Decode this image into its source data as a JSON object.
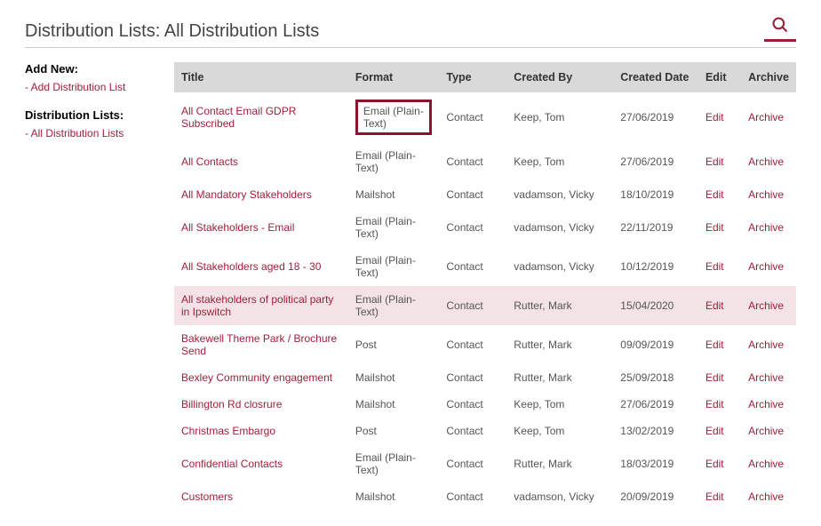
{
  "header": {
    "title": "Distribution Lists: All Distribution Lists"
  },
  "sidebar": {
    "add_new_heading": "Add New:",
    "add_link": "Add Distribution List",
    "lists_heading": "Distribution Lists:",
    "all_link": "All Distribution Lists"
  },
  "table": {
    "headers": {
      "title": "Title",
      "format": "Format",
      "type": "Type",
      "created_by": "Created By",
      "created_date": "Created Date",
      "edit": "Edit",
      "archive": "Archive"
    },
    "labels": {
      "edit": "Edit",
      "archive": "Archive"
    },
    "rows": [
      {
        "title": "All Contact Email GDPR Subscribed",
        "format": "Email (Plain-Text)",
        "type": "Contact",
        "created_by": "Keep, Tom",
        "created_date": "27/06/2019",
        "highlight_format_box": true
      },
      {
        "title": "All Contacts",
        "format": "Email (Plain-Text)",
        "type": "Contact",
        "created_by": "Keep, Tom",
        "created_date": "27/06/2019"
      },
      {
        "title": "All Mandatory Stakeholders",
        "format": "Mailshot",
        "type": "Contact",
        "created_by": "vadamson, Vicky",
        "created_date": "18/10/2019"
      },
      {
        "title": "All Stakeholders - Email",
        "format": "Email (Plain-Text)",
        "type": "Contact",
        "created_by": "vadamson, Vicky",
        "created_date": "22/11/2019"
      },
      {
        "title": "All Stakeholders aged 18 - 30",
        "format": "Email (Plain-Text)",
        "type": "Contact",
        "created_by": "vadamson, Vicky",
        "created_date": "10/12/2019"
      },
      {
        "title": "All stakeholders of political party in Ipswitch",
        "format": "Email (Plain-Text)",
        "type": "Contact",
        "created_by": "Rutter, Mark",
        "created_date": "15/04/2020",
        "row_highlight": true
      },
      {
        "title": "Bakewell Theme Park / Brochure Send",
        "format": "Post",
        "type": "Contact",
        "created_by": "Rutter, Mark",
        "created_date": "09/09/2019"
      },
      {
        "title": "Bexley Community engagement",
        "format": "Mailshot",
        "type": "Contact",
        "created_by": "Rutter, Mark",
        "created_date": "25/09/2018"
      },
      {
        "title": "Billington Rd closrure",
        "format": "Mailshot",
        "type": "Contact",
        "created_by": "Keep, Tom",
        "created_date": "27/06/2019"
      },
      {
        "title": "Christmas Embargo",
        "format": "Post",
        "type": "Contact",
        "created_by": "Keep, Tom",
        "created_date": "13/02/2019"
      },
      {
        "title": "Confidential Contacts",
        "format": "Email (Plain-Text)",
        "type": "Contact",
        "created_by": "Rutter, Mark",
        "created_date": "18/03/2019"
      },
      {
        "title": "Customers",
        "format": "Mailshot",
        "type": "Contact",
        "created_by": "vadamson, Vicky",
        "created_date": "20/09/2019"
      }
    ]
  },
  "colors": {
    "accent": "#a01e3a"
  }
}
